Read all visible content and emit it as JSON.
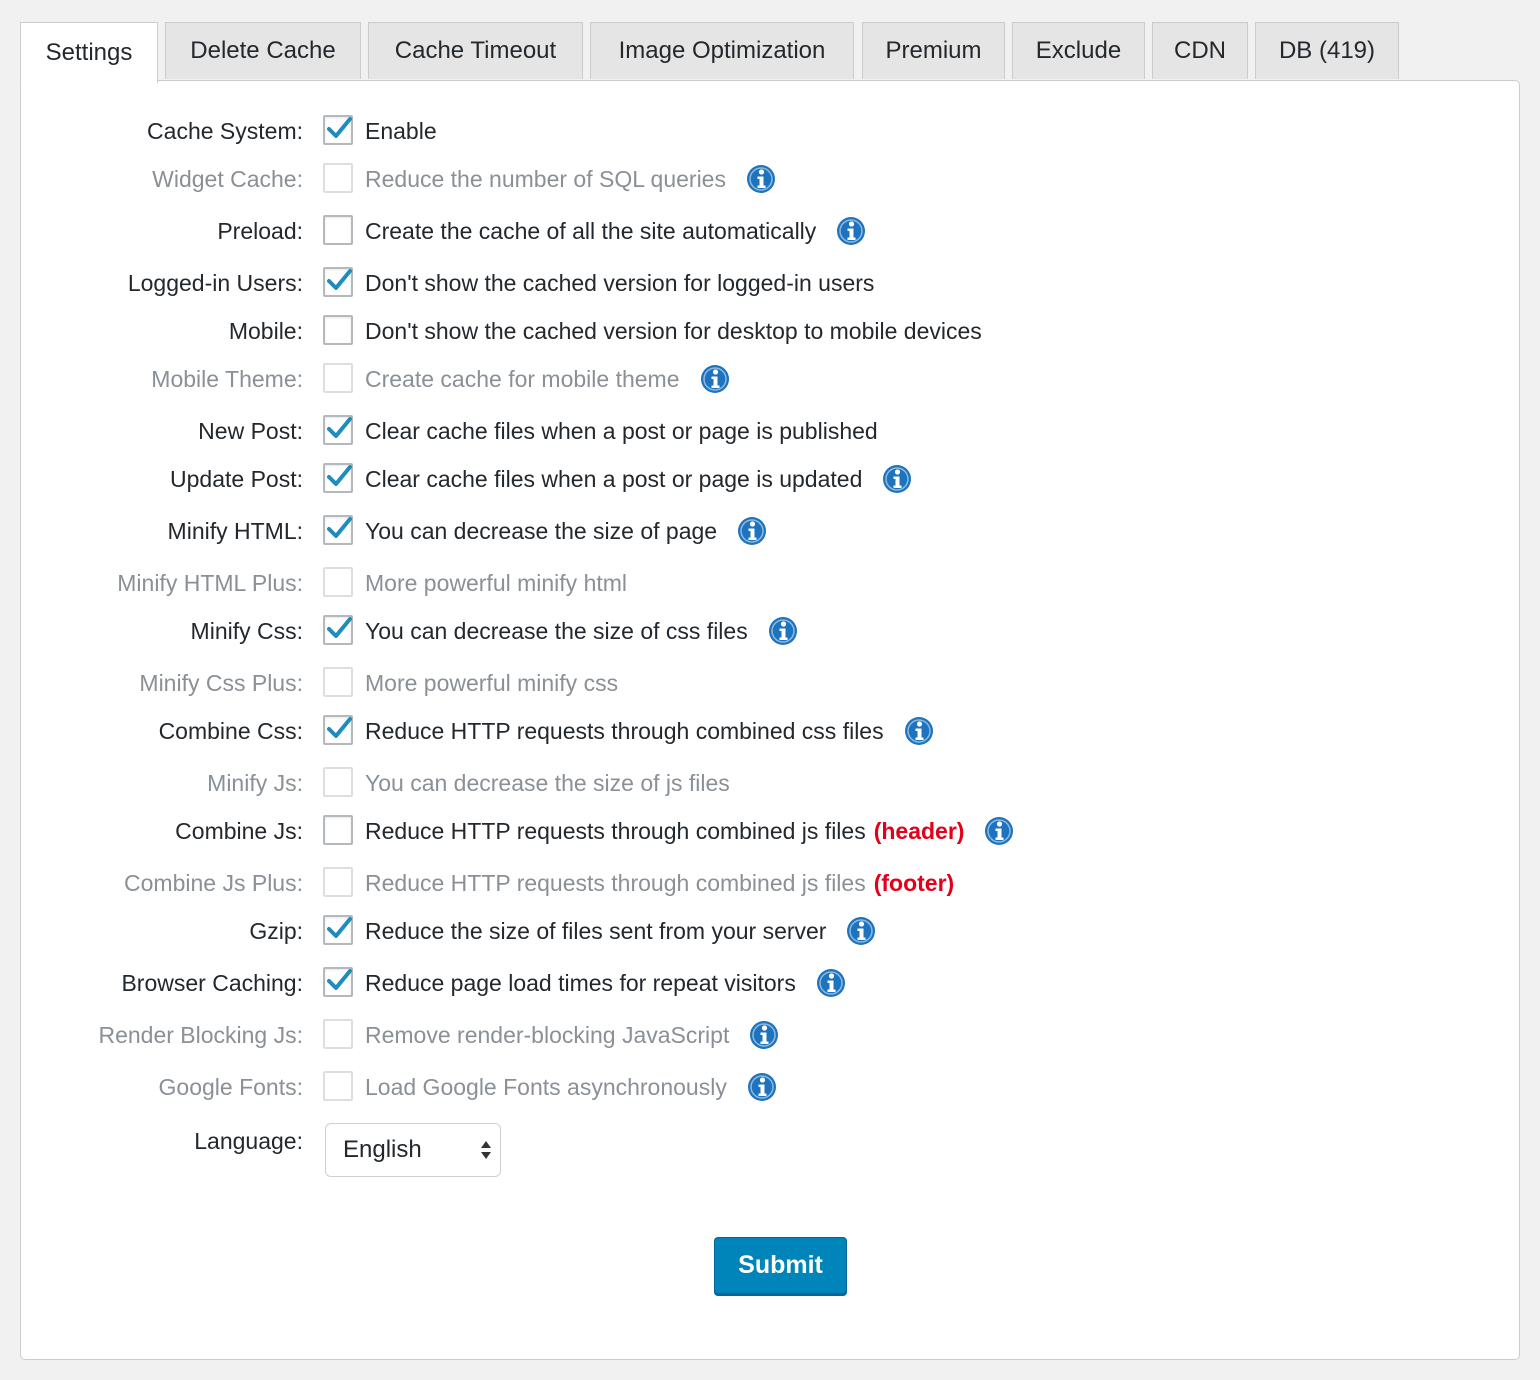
{
  "tabs": [
    {
      "label": "Settings",
      "active": true
    },
    {
      "label": "Delete Cache",
      "active": false
    },
    {
      "label": "Cache Timeout",
      "active": false
    },
    {
      "label": "Image Optimization",
      "active": false
    },
    {
      "label": "Premium",
      "active": false
    },
    {
      "label": "Exclude",
      "active": false
    },
    {
      "label": "CDN",
      "active": false
    },
    {
      "label": "DB (419)",
      "active": false
    }
  ],
  "settings": [
    {
      "label": "Cache System:",
      "desc": "Enable",
      "checked": true,
      "disabled": false,
      "info": false,
      "tag": ""
    },
    {
      "label": "Widget Cache:",
      "desc": "Reduce the number of SQL queries",
      "checked": false,
      "disabled": true,
      "info": true,
      "tag": ""
    },
    {
      "label": "Preload:",
      "desc": "Create the cache of all the site automatically",
      "checked": false,
      "disabled": false,
      "info": true,
      "tag": ""
    },
    {
      "label": "Logged-in Users:",
      "desc": "Don't show the cached version for logged-in users",
      "checked": true,
      "disabled": false,
      "info": false,
      "tag": ""
    },
    {
      "label": "Mobile:",
      "desc": "Don't show the cached version for desktop to mobile devices",
      "checked": false,
      "disabled": false,
      "info": false,
      "tag": ""
    },
    {
      "label": "Mobile Theme:",
      "desc": "Create cache for mobile theme",
      "checked": false,
      "disabled": true,
      "info": true,
      "tag": ""
    },
    {
      "label": "New Post:",
      "desc": "Clear cache files when a post or page is published",
      "checked": true,
      "disabled": false,
      "info": false,
      "tag": ""
    },
    {
      "label": "Update Post:",
      "desc": "Clear cache files when a post or page is updated",
      "checked": true,
      "disabled": false,
      "info": true,
      "tag": ""
    },
    {
      "label": "Minify HTML:",
      "desc": "You can decrease the size of page",
      "checked": true,
      "disabled": false,
      "info": true,
      "tag": ""
    },
    {
      "label": "Minify HTML Plus:",
      "desc": "More powerful minify html",
      "checked": false,
      "disabled": true,
      "info": false,
      "tag": ""
    },
    {
      "label": "Minify Css:",
      "desc": "You can decrease the size of css files",
      "checked": true,
      "disabled": false,
      "info": true,
      "tag": ""
    },
    {
      "label": "Minify Css Plus:",
      "desc": "More powerful minify css",
      "checked": false,
      "disabled": true,
      "info": false,
      "tag": ""
    },
    {
      "label": "Combine Css:",
      "desc": "Reduce HTTP requests through combined css files",
      "checked": true,
      "disabled": false,
      "info": true,
      "tag": ""
    },
    {
      "label": "Minify Js:",
      "desc": "You can decrease the size of js files",
      "checked": false,
      "disabled": true,
      "info": false,
      "tag": ""
    },
    {
      "label": "Combine Js:",
      "desc": "Reduce HTTP requests through combined js files",
      "checked": false,
      "disabled": false,
      "info": true,
      "tag": "(header)"
    },
    {
      "label": "Combine Js Plus:",
      "desc": "Reduce HTTP requests through combined js files",
      "checked": false,
      "disabled": true,
      "info": false,
      "tag": "(footer)"
    },
    {
      "label": "Gzip:",
      "desc": "Reduce the size of files sent from your server",
      "checked": true,
      "disabled": false,
      "info": true,
      "tag": ""
    },
    {
      "label": "Browser Caching:",
      "desc": "Reduce page load times for repeat visitors",
      "checked": true,
      "disabled": false,
      "info": true,
      "tag": ""
    },
    {
      "label": "Render Blocking Js:",
      "desc": "Remove render-blocking JavaScript",
      "checked": false,
      "disabled": true,
      "info": true,
      "tag": ""
    },
    {
      "label": "Google Fonts:",
      "desc": "Load Google Fonts asynchronously",
      "checked": false,
      "disabled": true,
      "info": true,
      "tag": ""
    }
  ],
  "language": {
    "label": "Language:",
    "value": "English"
  },
  "submit_label": "Submit",
  "colors": {
    "accent": "#0085ba",
    "check": "#1e8cbe",
    "info": "#1e73be",
    "tag": "#e3001b"
  }
}
